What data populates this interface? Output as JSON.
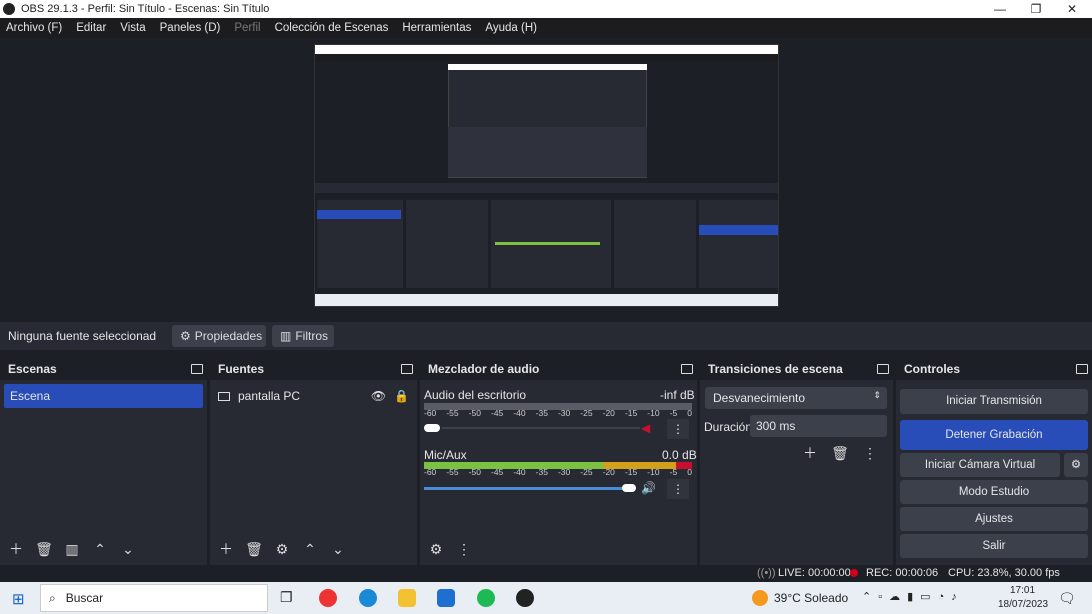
{
  "window": {
    "title": "OBS 29.1.3 - Perfil: Sin Título - Escenas: Sin Título",
    "minimize": "—",
    "maximize": "❐",
    "close": "✕"
  },
  "menu": [
    "Archivo (F)",
    "Editar",
    "Vista",
    "Paneles (D)",
    "Perfil",
    "Colección de Escenas",
    "Herramientas",
    "Ayuda (H)"
  ],
  "source_bar": {
    "status": "Ninguna fuente seleccionad",
    "properties": "Propiedades",
    "filters": "Filtros"
  },
  "scenes": {
    "title": "Escenas",
    "items": [
      "Escena"
    ]
  },
  "sources": {
    "title": "Fuentes",
    "items": [
      "pantalla PC"
    ]
  },
  "mixer": {
    "title": "Mezclador de audio",
    "ticks": [
      "-60",
      "-55",
      "-50",
      "-45",
      "-40",
      "-35",
      "-30",
      "-25",
      "-20",
      "-15",
      "-10",
      "-5",
      "0"
    ],
    "channels": [
      {
        "name": "Audio del escritorio",
        "level": "-inf dB",
        "volume": 0.03,
        "muted": true
      },
      {
        "name": "Mic/Aux",
        "level": "0.0 dB",
        "volume": 1.0,
        "muted": false
      }
    ]
  },
  "transitions": {
    "title": "Transiciones de escena",
    "selected": "Desvanecimiento",
    "duration_label": "Duración",
    "duration": "300 ms"
  },
  "controls": {
    "title": "Controles",
    "buttons": [
      "Iniciar Transmisión",
      "Detener Grabación",
      "Iniciar Cámara Virtual",
      "Modo Estudio",
      "Ajustes",
      "Salir"
    ]
  },
  "status": {
    "live": "LIVE: 00:00:00",
    "rec": "REC: 00:00:06",
    "cpu": "CPU: 23.8%, 30.00 fps"
  },
  "taskbar": {
    "search": "Buscar",
    "weather": "39°C  Soleado",
    "time": "17:01",
    "date": "18/07/2023"
  },
  "colors": {
    "accent": "#284cb8",
    "panel": "#272a33",
    "bg": "#1d1f26",
    "rec": "#d0021b"
  }
}
